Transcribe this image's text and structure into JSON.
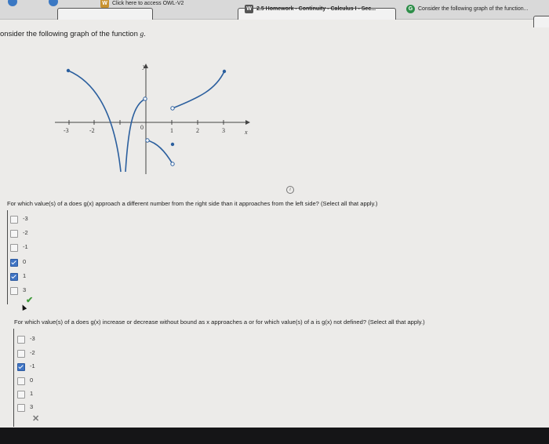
{
  "tabs": [
    {
      "label": "Click here to access OWL-V2",
      "icon": "owl-icon"
    },
    {
      "label": "2.5 Homework - Continuity - Calculus I - Sec...",
      "icon": "w-icon"
    },
    {
      "label": "Consider the following graph of the function...",
      "icon": "g-icon"
    }
  ],
  "prompt": {
    "prefix": "onsider the following graph of the function ",
    "fn": "g",
    "suffix": "."
  },
  "graph": {
    "y_label": "y",
    "x_label": "x",
    "origin_label": "0",
    "tick_labels": [
      "-3",
      "-2",
      "1",
      "2",
      "3"
    ]
  },
  "q1": {
    "text": "For which value(s) of a does g(x) approach a different number from the right side than it approaches from the left side? (Select all that apply.)",
    "options": [
      {
        "label": "-3",
        "checked": false
      },
      {
        "label": "-2",
        "checked": false
      },
      {
        "label": "-1",
        "checked": false
      },
      {
        "label": "0",
        "checked": true
      },
      {
        "label": "1",
        "checked": true
      },
      {
        "label": "3",
        "checked": false
      }
    ],
    "result": "correct"
  },
  "q2": {
    "text": "For which value(s) of a does g(x) increase or decrease without bound as x approaches a or for which value(s) of a is g(x) not defined? (Select all that apply.)",
    "options": [
      {
        "label": "-3",
        "checked": false
      },
      {
        "label": "-2",
        "checked": false
      },
      {
        "label": "-1",
        "checked": true
      },
      {
        "label": "0",
        "checked": false
      },
      {
        "label": "1",
        "checked": false
      },
      {
        "label": "3",
        "checked": false
      }
    ],
    "result": "incorrect"
  },
  "colors": {
    "checkbox_checked": "#3f74c4",
    "correct": "#3f9a3a",
    "page": "#ecebe9"
  }
}
